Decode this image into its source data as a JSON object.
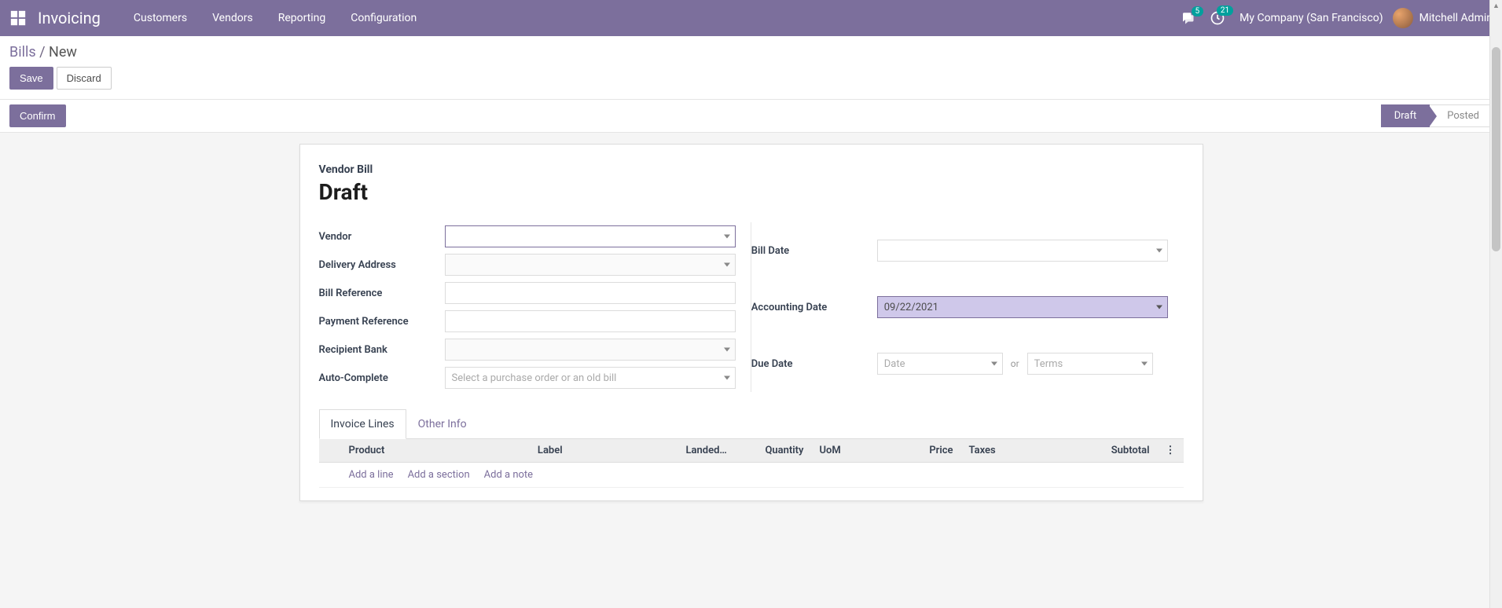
{
  "nav": {
    "brand": "Invoicing",
    "menu": [
      "Customers",
      "Vendors",
      "Reporting",
      "Configuration"
    ],
    "messages_badge": "5",
    "activities_badge": "21",
    "company": "My Company (San Francisco)",
    "user": "Mitchell Admin"
  },
  "breadcrumb": {
    "parent": "Bills",
    "current": "New"
  },
  "buttons": {
    "save": "Save",
    "discard": "Discard",
    "confirm": "Confirm"
  },
  "statusbar": {
    "stages": [
      "Draft",
      "Posted"
    ],
    "active_index": 0
  },
  "title": {
    "move_type": "Vendor Bill",
    "name": "Draft"
  },
  "form": {
    "left": {
      "vendor_label": "Vendor",
      "vendor_value": "",
      "delivery_label": "Delivery Address",
      "delivery_value": "",
      "billref_label": "Bill Reference",
      "billref_value": "",
      "payref_label": "Payment Reference",
      "payref_value": "",
      "bank_label": "Recipient Bank",
      "bank_value": "",
      "autocomplete_label": "Auto-Complete",
      "autocomplete_placeholder": "Select a purchase order or an old bill"
    },
    "right": {
      "billdate_label": "Bill Date",
      "billdate_value": "",
      "acctdate_label": "Accounting Date",
      "acctdate_value": "09/22/2021",
      "duedate_label": "Due Date",
      "duedate_date_placeholder": "Date",
      "duedate_or": "or",
      "duedate_terms_placeholder": "Terms"
    }
  },
  "tabs": {
    "invoice_lines": "Invoice Lines",
    "other_info": "Other Info"
  },
  "columns": {
    "product": "Product",
    "label": "Label",
    "landed": "Landed…",
    "quantity": "Quantity",
    "uom": "UoM",
    "price": "Price",
    "taxes": "Taxes",
    "subtotal": "Subtotal"
  },
  "bottom_links": {
    "add_line": "Add a line",
    "add_section": "Add a section",
    "add_note": "Add a note"
  }
}
